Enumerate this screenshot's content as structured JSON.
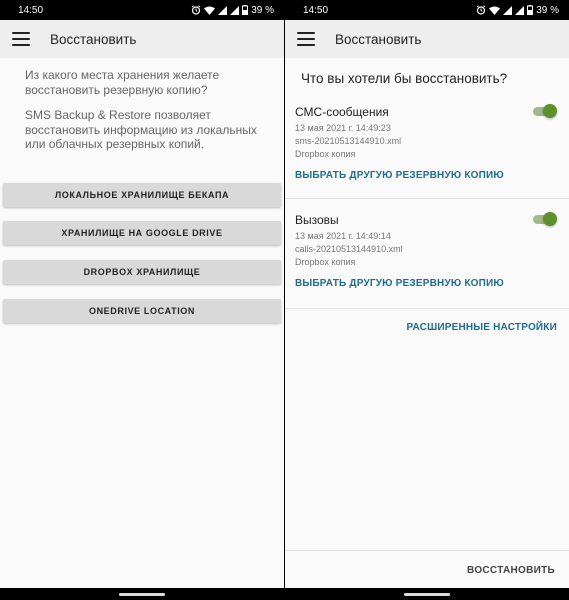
{
  "status": {
    "time": "14:50",
    "battery": "39 %"
  },
  "left": {
    "title": "Восстановить",
    "question": "Из какого места хранения желаете восстановить резервную копию?",
    "description": "SMS Backup & Restore позволяет восстановить информацию из локальных или облачных резервных копий.",
    "buttons": [
      {
        "label": "ЛОКАЛЬНОЕ ХРАНИЛИЩЕ БЕКАПА"
      },
      {
        "label": "ХРАНИЛИЩЕ НА GOOGLE DRIVE"
      },
      {
        "label": "DROPBOX ХРАНИЛИЩЕ"
      },
      {
        "label": "ONEDRIVE LOCATION"
      }
    ]
  },
  "right": {
    "title": "Восстановить",
    "question": "Что вы хотели бы восстановить?",
    "items": [
      {
        "title": "СМС-сообщения",
        "date": "13 мая 2021 г. 14:49:23",
        "file": "sms-20210513144910.xml",
        "source": "Dropbox копия",
        "enabled": true,
        "link": "ВЫБРАТЬ ДРУГУЮ РЕЗЕРВНУЮ КОПИЮ"
      },
      {
        "title": "Вызовы",
        "date": "13 мая 2021 г. 14:49:14",
        "file": "calls-20210513144910.xml",
        "source": "Dropbox копия",
        "enabled": true,
        "link": "ВЫБРАТЬ ДРУГУЮ РЕЗЕРВНУЮ КОПИЮ"
      }
    ],
    "advanced": "РАСШИРЕННЫЕ НАСТРОЙКИ",
    "restore": "ВОССТАНОВИТЬ"
  },
  "colors": {
    "accent": "#1b6e92",
    "toggle_on": "#5d8f2a",
    "app_bar": "#eeeeee"
  },
  "icons": [
    "menu-icon",
    "alarm-icon",
    "wifi-icon",
    "signal-icon",
    "battery-icon"
  ]
}
